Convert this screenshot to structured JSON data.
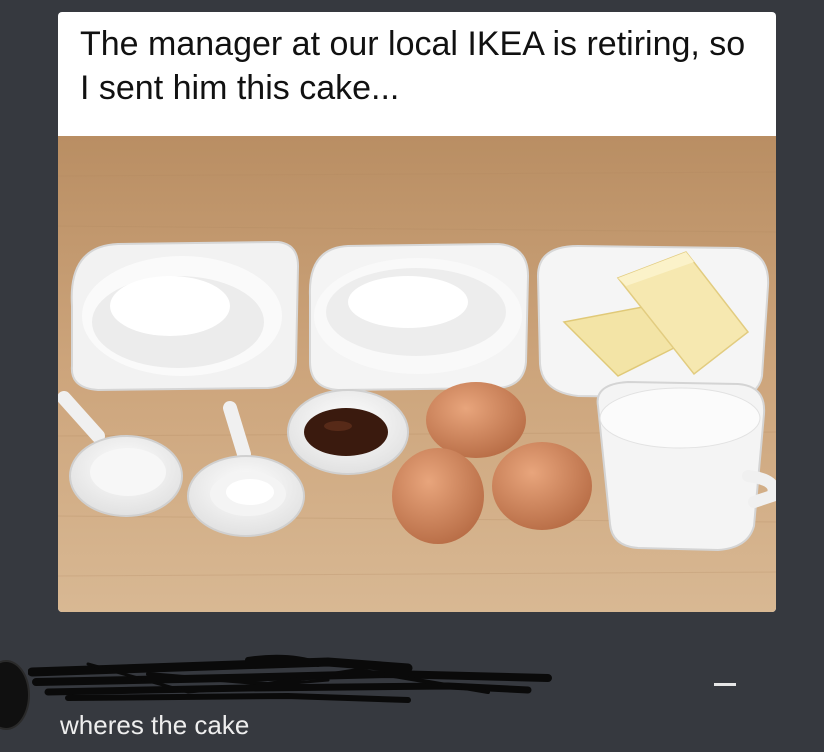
{
  "post": {
    "caption": "The manager at our local IKEA is retiring, so I sent him this cake..."
  },
  "comment": {
    "text": "wheres the cake",
    "separator": "-"
  },
  "colors": {
    "background": "#36393f",
    "card": "#ffffff",
    "table_wood": "#c9a47a"
  }
}
